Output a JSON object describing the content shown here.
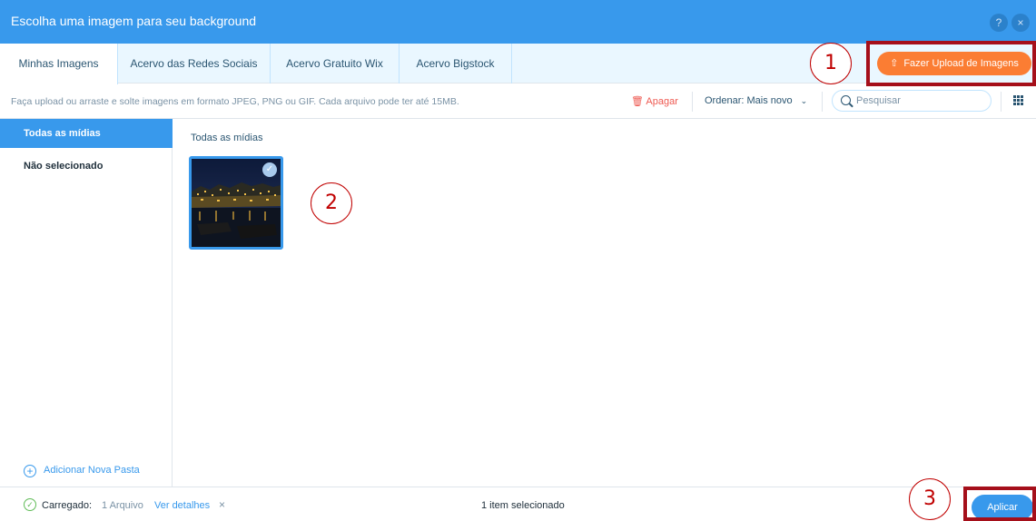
{
  "colors": {
    "header": "#3899ec",
    "tabs_bg": "#eaf7ff",
    "upload_button": "#fb7d33",
    "apply_button": "#3899ec",
    "delete_text": "#ee5951",
    "annotation": "#c00000",
    "success": "#60bc57"
  },
  "header": {
    "title": "Escolha uma imagem para seu background",
    "help_label": "?",
    "close_label": "×"
  },
  "tabs": [
    {
      "label": "Minhas Imagens",
      "active": true
    },
    {
      "label": "Acervo das Redes Sociais",
      "active": false
    },
    {
      "label": "Acervo Gratuito Wix",
      "active": false
    },
    {
      "label": "Acervo Bigstock",
      "active": false
    }
  ],
  "upload_button": {
    "icon": "upload-icon",
    "label": "Fazer Upload de Imagens"
  },
  "toolbar": {
    "hint": "Faça upload ou arraste e solte imagens em formato JPEG, PNG ou GIF. Cada arquivo pode ter até 15MB.",
    "delete_label": "Apagar",
    "sort_label": "Ordenar: Mais novo",
    "search_placeholder": "Pesquisar"
  },
  "sidebar": {
    "items": [
      {
        "label": "Todas as mídias",
        "active": true
      },
      {
        "label": "Não selecionado",
        "active": false
      }
    ],
    "add_folder_label": "Adicionar Nova Pasta"
  },
  "content": {
    "title": "Todas as mídias",
    "images": [
      {
        "selected": true
      }
    ]
  },
  "annotations": {
    "step1": "1",
    "step2": "2",
    "step3": "3"
  },
  "footer": {
    "uploaded_label": "Carregado:",
    "uploaded_count": "1 Arquivo",
    "details_link": "Ver detalhes",
    "close_label": "×",
    "selected_count": "1 item selecionado",
    "apply_label": "Aplicar"
  }
}
